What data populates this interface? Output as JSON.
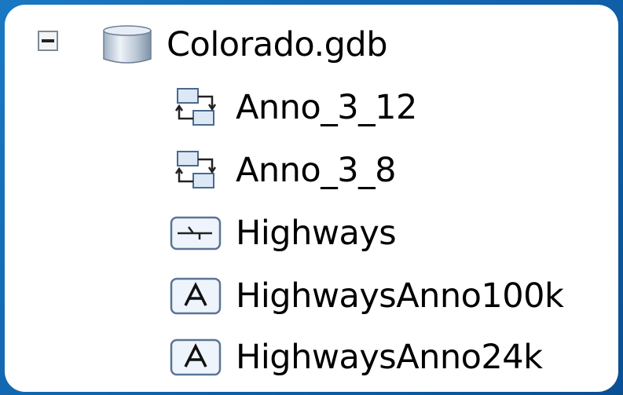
{
  "tree": {
    "root": {
      "label": "Colorado.gdb",
      "icon": "geodatabase-icon",
      "expanded": true
    },
    "children": [
      {
        "label": "Anno_3_12",
        "icon": "annotation-class-icon"
      },
      {
        "label": "Anno_3_8",
        "icon": "annotation-class-icon"
      },
      {
        "label": "Highways",
        "icon": "line-feature-class-icon"
      },
      {
        "label": "HighwaysAnno100k",
        "icon": "annotation-feature-class-icon"
      },
      {
        "label": "HighwaysAnno24k",
        "icon": "annotation-feature-class-icon"
      }
    ]
  },
  "colors": {
    "background": "#1a78c2",
    "panel": "#ffffff",
    "icon_stroke": "#4a6a8c",
    "icon_fill": "#dce8f5"
  }
}
